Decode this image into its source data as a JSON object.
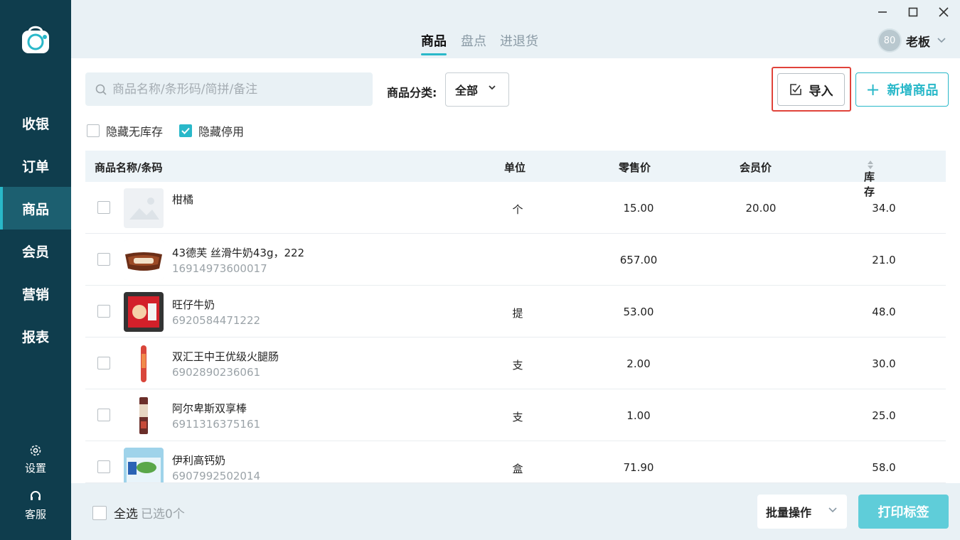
{
  "sidebar": {
    "items": [
      {
        "label": "收银"
      },
      {
        "label": "订单"
      },
      {
        "label": "商品"
      },
      {
        "label": "会员"
      },
      {
        "label": "营销"
      },
      {
        "label": "报表"
      }
    ],
    "settings_label": "设置",
    "support_label": "客服"
  },
  "header": {
    "tabs": [
      {
        "label": "商品"
      },
      {
        "label": "盘点"
      },
      {
        "label": "进退货"
      }
    ],
    "user": {
      "avatar_text": "80",
      "name": "老板"
    }
  },
  "toolbar": {
    "search_placeholder": "商品名称/条形码/简拼/备注",
    "category_label": "商品分类:",
    "category_value": "全部",
    "import_label": "导入",
    "add_label": "新增商品"
  },
  "filters": {
    "hide_no_stock": "隐藏无库存",
    "hide_disabled": "隐藏停用"
  },
  "table": {
    "columns": [
      "商品名称/条码",
      "单位",
      "零售价",
      "会员价",
      "库存"
    ],
    "rows": [
      {
        "name": "柑橘",
        "code": "",
        "unit": "个",
        "retail": "15.00",
        "member": "20.00",
        "stock": "34.0"
      },
      {
        "name": "43德芙 丝滑牛奶43g，222",
        "code": "16914973600017",
        "unit": "",
        "retail": "657.00",
        "member": "",
        "stock": "21.0"
      },
      {
        "name": "旺仔牛奶",
        "code": "6920584471222",
        "unit": "提",
        "retail": "53.00",
        "member": "",
        "stock": "48.0"
      },
      {
        "name": "双汇王中王优级火腿肠",
        "code": "6902890236061",
        "unit": "支",
        "retail": "2.00",
        "member": "",
        "stock": "30.0"
      },
      {
        "name": "阿尔卑斯双享棒",
        "code": "6911316375161",
        "unit": "支",
        "retail": "1.00",
        "member": "",
        "stock": "25.0"
      },
      {
        "name": "伊利高钙奶",
        "code": "6907992502014",
        "unit": "盒",
        "retail": "71.90",
        "member": "",
        "stock": "58.0"
      }
    ]
  },
  "footer": {
    "select_all": "全选",
    "selected_count": "已选0个",
    "batch_label": "批量操作",
    "print_label": "打印标签"
  },
  "colors": {
    "sidebar": "#0f3d4d",
    "accent": "#29b8c9",
    "highlight": "#e0433a"
  }
}
